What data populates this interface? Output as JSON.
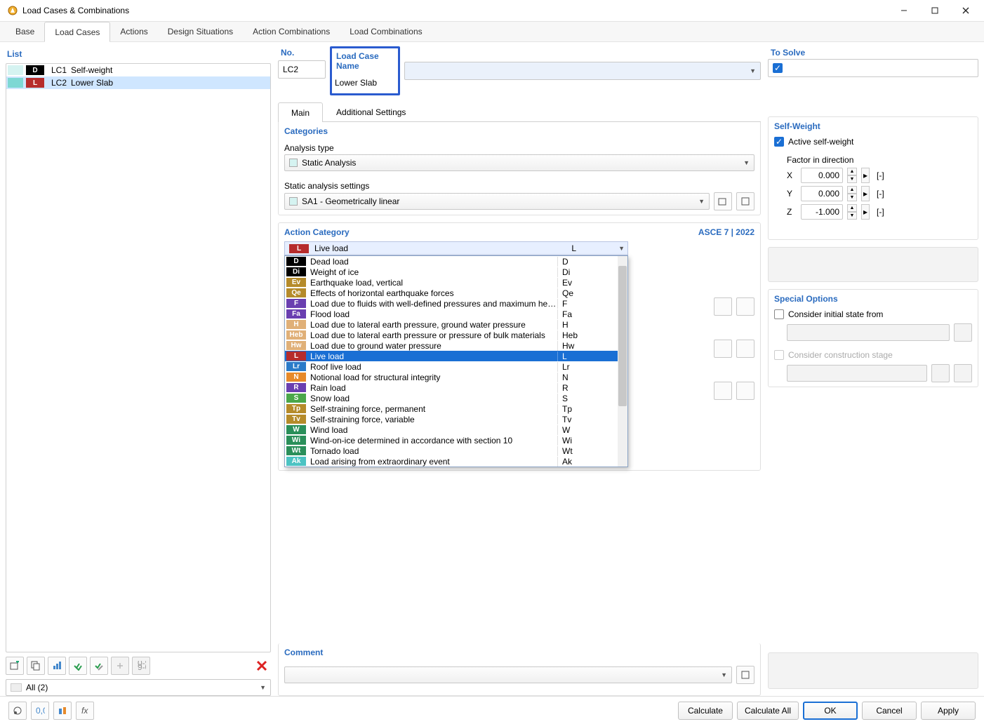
{
  "window": {
    "title": "Load Cases & Combinations"
  },
  "tabs": [
    "Base",
    "Load Cases",
    "Actions",
    "Design Situations",
    "Action Combinations",
    "Load Combinations"
  ],
  "active_tab": 1,
  "left": {
    "header": "List",
    "items": [
      {
        "sw": "#d5f3f1",
        "badge_bg": "#000000",
        "badge": "D",
        "id": "LC1",
        "name": "Self-weight"
      },
      {
        "sw": "#7ed8d4",
        "badge_bg": "#b62c2c",
        "badge": "L",
        "id": "LC2",
        "name": "Lower Slab"
      }
    ],
    "filter": "All (2)"
  },
  "header_row": {
    "no_label": "No.",
    "no_value": "LC2",
    "name_label": "Load Case Name",
    "name_value": "Lower Slab",
    "solve_label": "To Solve"
  },
  "sub_tabs": [
    "Main",
    "Additional Settings"
  ],
  "categories": {
    "title": "Categories",
    "analysis_label": "Analysis type",
    "analysis_value": "Static Analysis",
    "settings_label": "Static analysis settings",
    "settings_value": "SA1 - Geometrically linear"
  },
  "action_category": {
    "title": "Action Category",
    "code": "ASCE 7 | 2022",
    "selected": {
      "badge": "L",
      "badge_bg": "#b62c2c",
      "name": "Live load",
      "sym": "L"
    },
    "options": [
      {
        "badge": "D",
        "bg": "#000000",
        "name": "Dead load",
        "sym": "D"
      },
      {
        "badge": "Di",
        "bg": "#000000",
        "name": "Weight of ice",
        "sym": "Di"
      },
      {
        "badge": "Ev",
        "bg": "#b58b2a",
        "name": "Earthquake load, vertical",
        "sym": "Ev"
      },
      {
        "badge": "Qe",
        "bg": "#b58b2a",
        "name": "Effects of horizontal earthquake forces",
        "sym": "Qe"
      },
      {
        "badge": "F",
        "bg": "#6a3fb0",
        "name": "Load due to fluids with well-defined pressures and maximum heights",
        "sym": "F"
      },
      {
        "badge": "Fa",
        "bg": "#6a3fb0",
        "name": "Flood load",
        "sym": "Fa"
      },
      {
        "badge": "H",
        "bg": "#e0b078",
        "name": "Load due to lateral earth pressure, ground water pressure",
        "sym": "H"
      },
      {
        "badge": "Heb",
        "bg": "#e0b078",
        "name": "Load due to lateral earth pressure or pressure of bulk materials",
        "sym": "Heb"
      },
      {
        "badge": "Hw",
        "bg": "#e0b078",
        "name": "Load due to ground water pressure",
        "sym": "Hw"
      },
      {
        "badge": "L",
        "bg": "#b62c2c",
        "name": "Live load",
        "sym": "L",
        "selected": true
      },
      {
        "badge": "Lr",
        "bg": "#2a7bc9",
        "name": "Roof live load",
        "sym": "Lr"
      },
      {
        "badge": "N",
        "bg": "#e78a2a",
        "name": "Notional load for structural integrity",
        "sym": "N"
      },
      {
        "badge": "R",
        "bg": "#6a3fb0",
        "name": "Rain load",
        "sym": "R"
      },
      {
        "badge": "S",
        "bg": "#4aa74a",
        "name": "Snow load",
        "sym": "S"
      },
      {
        "badge": "Tp",
        "bg": "#b58b2a",
        "name": "Self-straining force, permanent",
        "sym": "Tp"
      },
      {
        "badge": "Tv",
        "bg": "#b58b2a",
        "name": "Self-straining force, variable",
        "sym": "Tv"
      },
      {
        "badge": "W",
        "bg": "#2a8f5a",
        "name": "Wind load",
        "sym": "W"
      },
      {
        "badge": "Wi",
        "bg": "#2a8f5a",
        "name": "Wind-on-ice determined in accordance with section 10",
        "sym": "Wi"
      },
      {
        "badge": "Wt",
        "bg": "#2a8f5a",
        "name": "Tornado load",
        "sym": "Wt"
      },
      {
        "badge": "Ak",
        "bg": "#4cc3c3",
        "name": "Load arising from extraordinary event",
        "sym": "Ak"
      }
    ]
  },
  "self_weight": {
    "title": "Self-Weight",
    "active_label": "Active self-weight",
    "factor_label": "Factor in direction",
    "rows": [
      {
        "axis": "X",
        "val": "0.000",
        "unit": "[-]"
      },
      {
        "axis": "Y",
        "val": "0.000",
        "unit": "[-]"
      },
      {
        "axis": "Z",
        "val": "-1.000",
        "unit": "[-]"
      }
    ]
  },
  "special": {
    "title": "Special Options",
    "initial_label": "Consider initial state from",
    "construction_label": "Consider construction stage"
  },
  "comment_label": "Comment",
  "buttons": {
    "calc": "Calculate",
    "calc_all": "Calculate All",
    "ok": "OK",
    "cancel": "Cancel",
    "apply": "Apply"
  }
}
